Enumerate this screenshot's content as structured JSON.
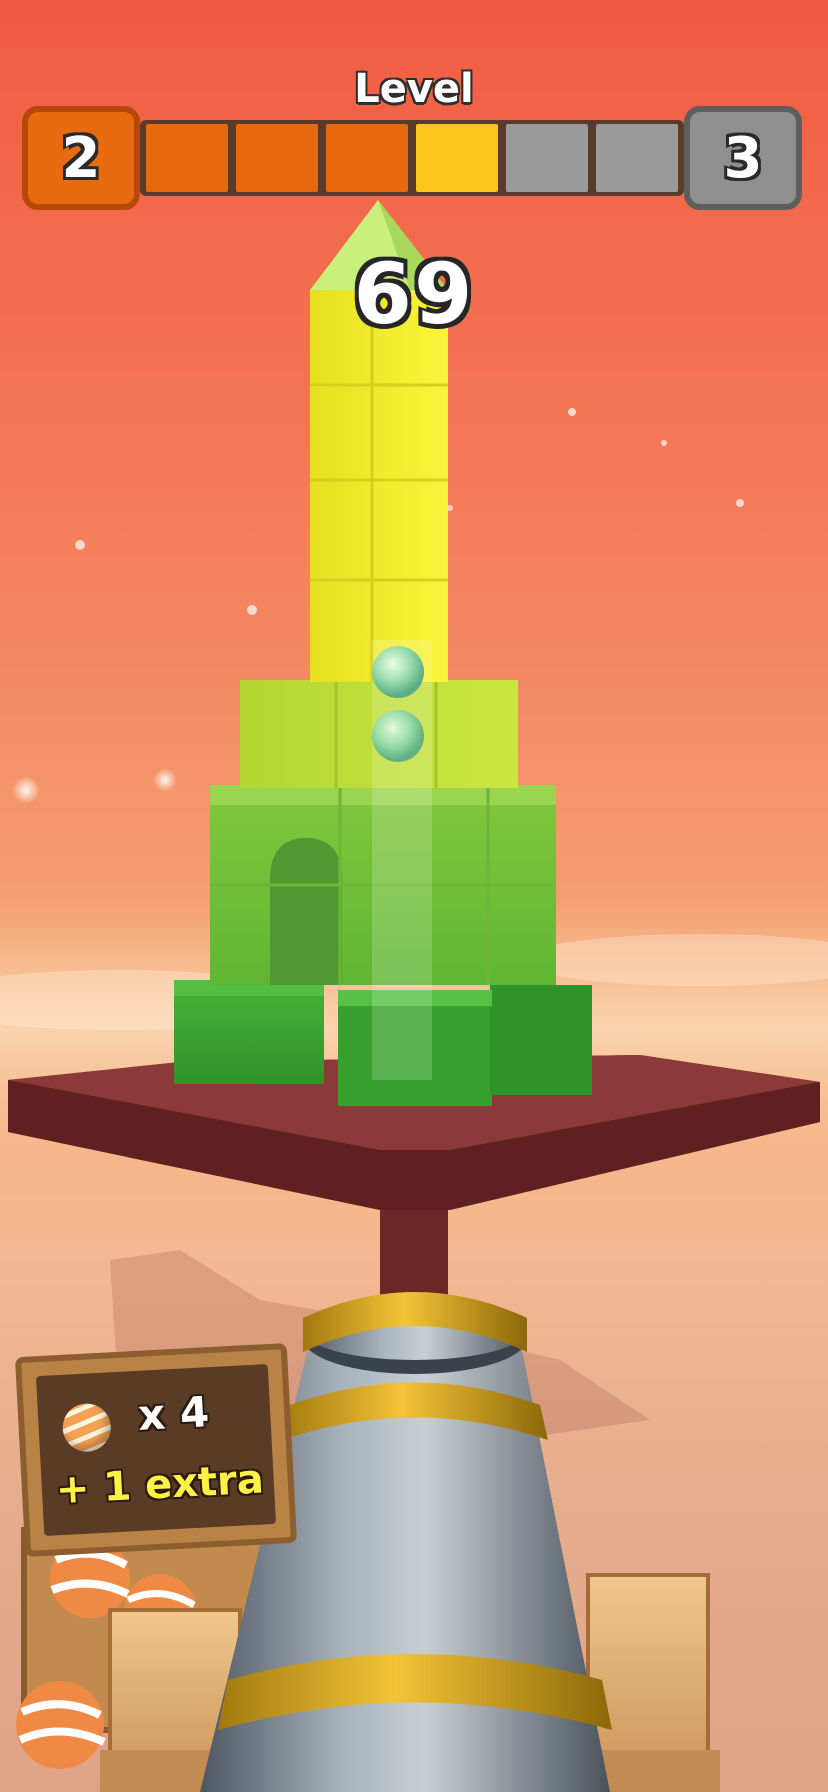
{
  "hud": {
    "title": "Level",
    "current_level": "2",
    "next_level": "3",
    "progress": {
      "segments_total": 6,
      "segments_completed": 3,
      "active_segment": 4
    },
    "colors": {
      "completed": "#e8680c",
      "active": "#fbc51c",
      "pending": "#9a9a9a"
    }
  },
  "score": "69",
  "ammo_sign": {
    "multiplier": "x 4",
    "bonus": "+ 1 extra",
    "icon": "striped-ball-icon"
  },
  "scene": {
    "tower_colors": [
      "#f4f02a",
      "#c9e43a",
      "#79c13a",
      "#3ea832"
    ],
    "platform_color": "#7a2f2f",
    "cannon": "metal-cannon",
    "projectiles_in_flight": 2
  }
}
